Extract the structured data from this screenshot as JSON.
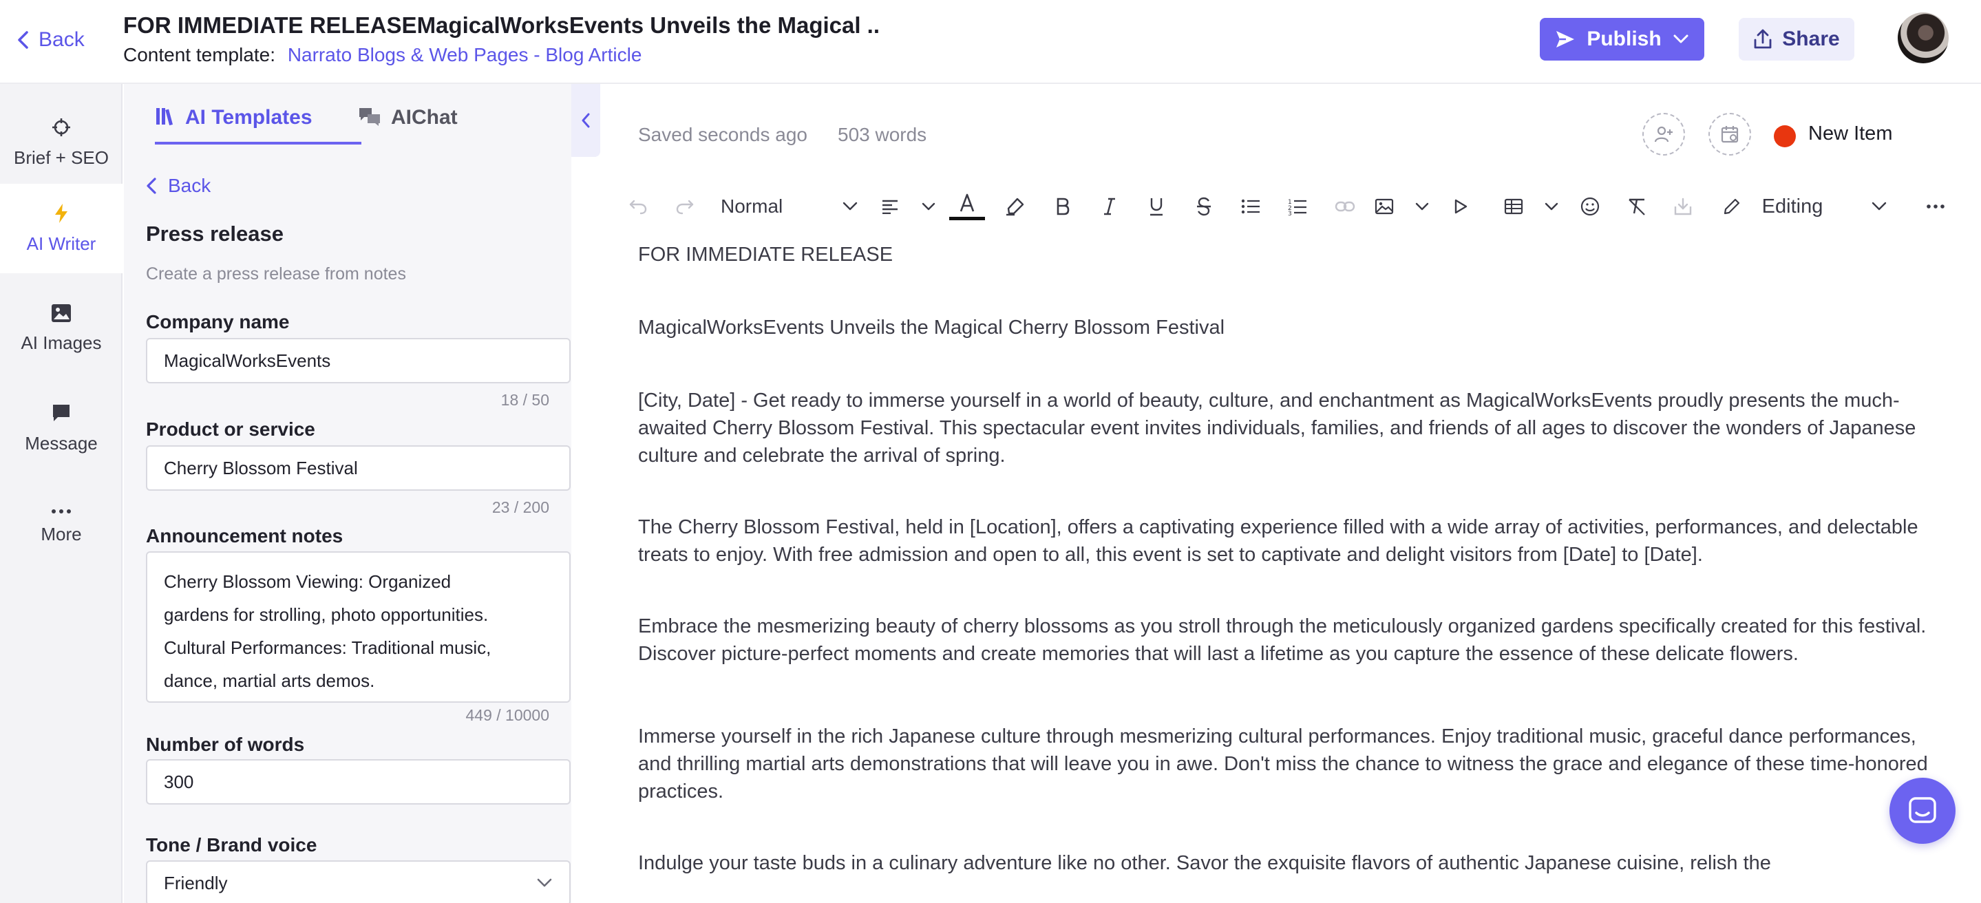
{
  "header": {
    "back_label": "Back",
    "title": "FOR IMMEDIATE RELEASEMagicalWorksEvents Unveils the Magical ..",
    "template_prefix": "Content template:",
    "template_link": "Narrato Blogs & Web Pages - Blog Article",
    "publish_label": "Publish",
    "share_label": "Share"
  },
  "rail": {
    "items": [
      {
        "label": "Brief + SEO",
        "icon": "crosshair-icon"
      },
      {
        "label": "AI Writer",
        "icon": "lightning-icon"
      },
      {
        "label": "AI Images",
        "icon": "image-icon"
      },
      {
        "label": "Message",
        "icon": "chat-bubble-icon"
      },
      {
        "label": "More",
        "icon": "dots-icon"
      }
    ]
  },
  "panel": {
    "tabs": [
      {
        "label": "AI Templates"
      },
      {
        "label": "AIChat"
      }
    ],
    "back_label": "Back",
    "title": "Press release",
    "subtitle": "Create a press release from notes",
    "fields": {
      "company": {
        "label": "Company name",
        "value": "MagicalWorksEvents",
        "count": "18 / 50"
      },
      "product": {
        "label": "Product or service",
        "value": "Cherry Blossom Festival",
        "count": "23 / 200"
      },
      "notes": {
        "label": "Announcement notes",
        "lines": [
          "Cherry Blossom Viewing: Organized",
          "gardens for strolling, photo opportunities.",
          "Cultural Performances: Traditional music,",
          "dance, martial arts demos."
        ],
        "count": "449 / 10000"
      },
      "words": {
        "label": "Number of words",
        "value": "300"
      },
      "tone": {
        "label": "Tone / Brand voice",
        "value": "Friendly"
      }
    }
  },
  "editor": {
    "saved_status": "Saved seconds ago",
    "word_count": "503 words",
    "item_status": "New Item",
    "status_color": "#e8360f",
    "toolbar": {
      "style_value": "Normal",
      "mode_value": "Editing"
    },
    "paragraphs": [
      "FOR IMMEDIATE RELEASE",
      "MagicalWorksEvents Unveils the Magical Cherry Blossom Festival",
      "[City, Date] - Get ready to immerse yourself in a world of beauty, culture, and enchantment as MagicalWorksEvents proudly presents the much-awaited Cherry Blossom Festival. This spectacular event invites individuals, families, and friends of all ages to discover the wonders of Japanese culture and celebrate the arrival of spring.",
      "The Cherry Blossom Festival, held in [Location], offers a captivating experience filled with a wide array of activities, performances, and delectable treats to enjoy. With free admission and open to all, this event is set to captivate and delight visitors from [Date] to [Date].",
      "Embrace the mesmerizing beauty of cherry blossoms as you stroll through the meticulously organized gardens specifically created for this festival. Discover picture-perfect moments and create memories that will last a lifetime as you capture the essence of these delicate flowers.",
      "Immerse yourself in the rich Japanese culture through mesmerizing cultural performances. Enjoy traditional music, graceful dance performances, and thrilling martial arts demonstrations that will leave you in awe. Don't miss the chance to witness the grace and elegance of these time-honored practices.",
      "Indulge your taste buds in a culinary adventure like no other. Savor the exquisite flavors of authentic Japanese cuisine, relish the"
    ]
  },
  "colors": {
    "accent": "#6c63f0",
    "link": "#5b55e8"
  }
}
